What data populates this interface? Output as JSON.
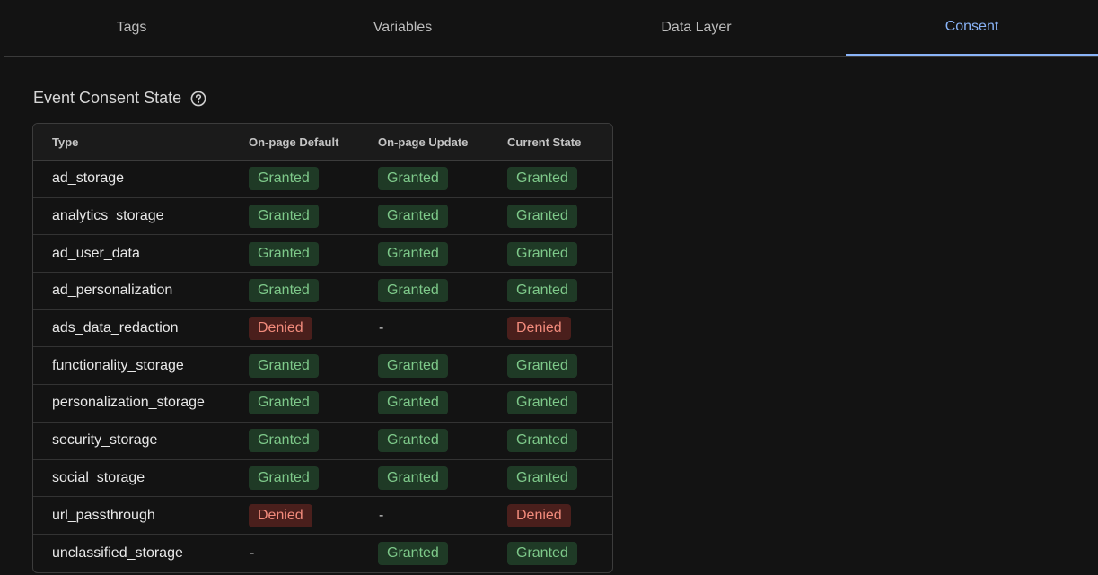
{
  "tabs": [
    {
      "label": "Tags"
    },
    {
      "label": "Variables"
    },
    {
      "label": "Data Layer"
    },
    {
      "label": "Consent"
    }
  ],
  "section": {
    "title": "Event Consent State",
    "help_icon": "help-circle-icon"
  },
  "table": {
    "headers": [
      "Type",
      "On-page Default",
      "On-page Update",
      "Current State"
    ],
    "rows": [
      {
        "type": "ad_storage",
        "default": "Granted",
        "update": "Granted",
        "current": "Granted"
      },
      {
        "type": "analytics_storage",
        "default": "Granted",
        "update": "Granted",
        "current": "Granted"
      },
      {
        "type": "ad_user_data",
        "default": "Granted",
        "update": "Granted",
        "current": "Granted"
      },
      {
        "type": "ad_personalization",
        "default": "Granted",
        "update": "Granted",
        "current": "Granted"
      },
      {
        "type": "ads_data_redaction",
        "default": "Denied",
        "update": "-",
        "current": "Denied"
      },
      {
        "type": "functionality_storage",
        "default": "Granted",
        "update": "Granted",
        "current": "Granted"
      },
      {
        "type": "personalization_storage",
        "default": "Granted",
        "update": "Granted",
        "current": "Granted"
      },
      {
        "type": "security_storage",
        "default": "Granted",
        "update": "Granted",
        "current": "Granted"
      },
      {
        "type": "social_storage",
        "default": "Granted",
        "update": "Granted",
        "current": "Granted"
      },
      {
        "type": "url_passthrough",
        "default": "Denied",
        "update": "-",
        "current": "Denied"
      },
      {
        "type": "unclassified_storage",
        "default": "-",
        "update": "Granted",
        "current": "Granted"
      }
    ]
  },
  "colors": {
    "accent": "#8ab4f8",
    "granted_bg": "#1f3a26",
    "granted_text": "#7ec98a",
    "denied_bg": "#4a1f1c",
    "denied_text": "#f28b7c"
  }
}
